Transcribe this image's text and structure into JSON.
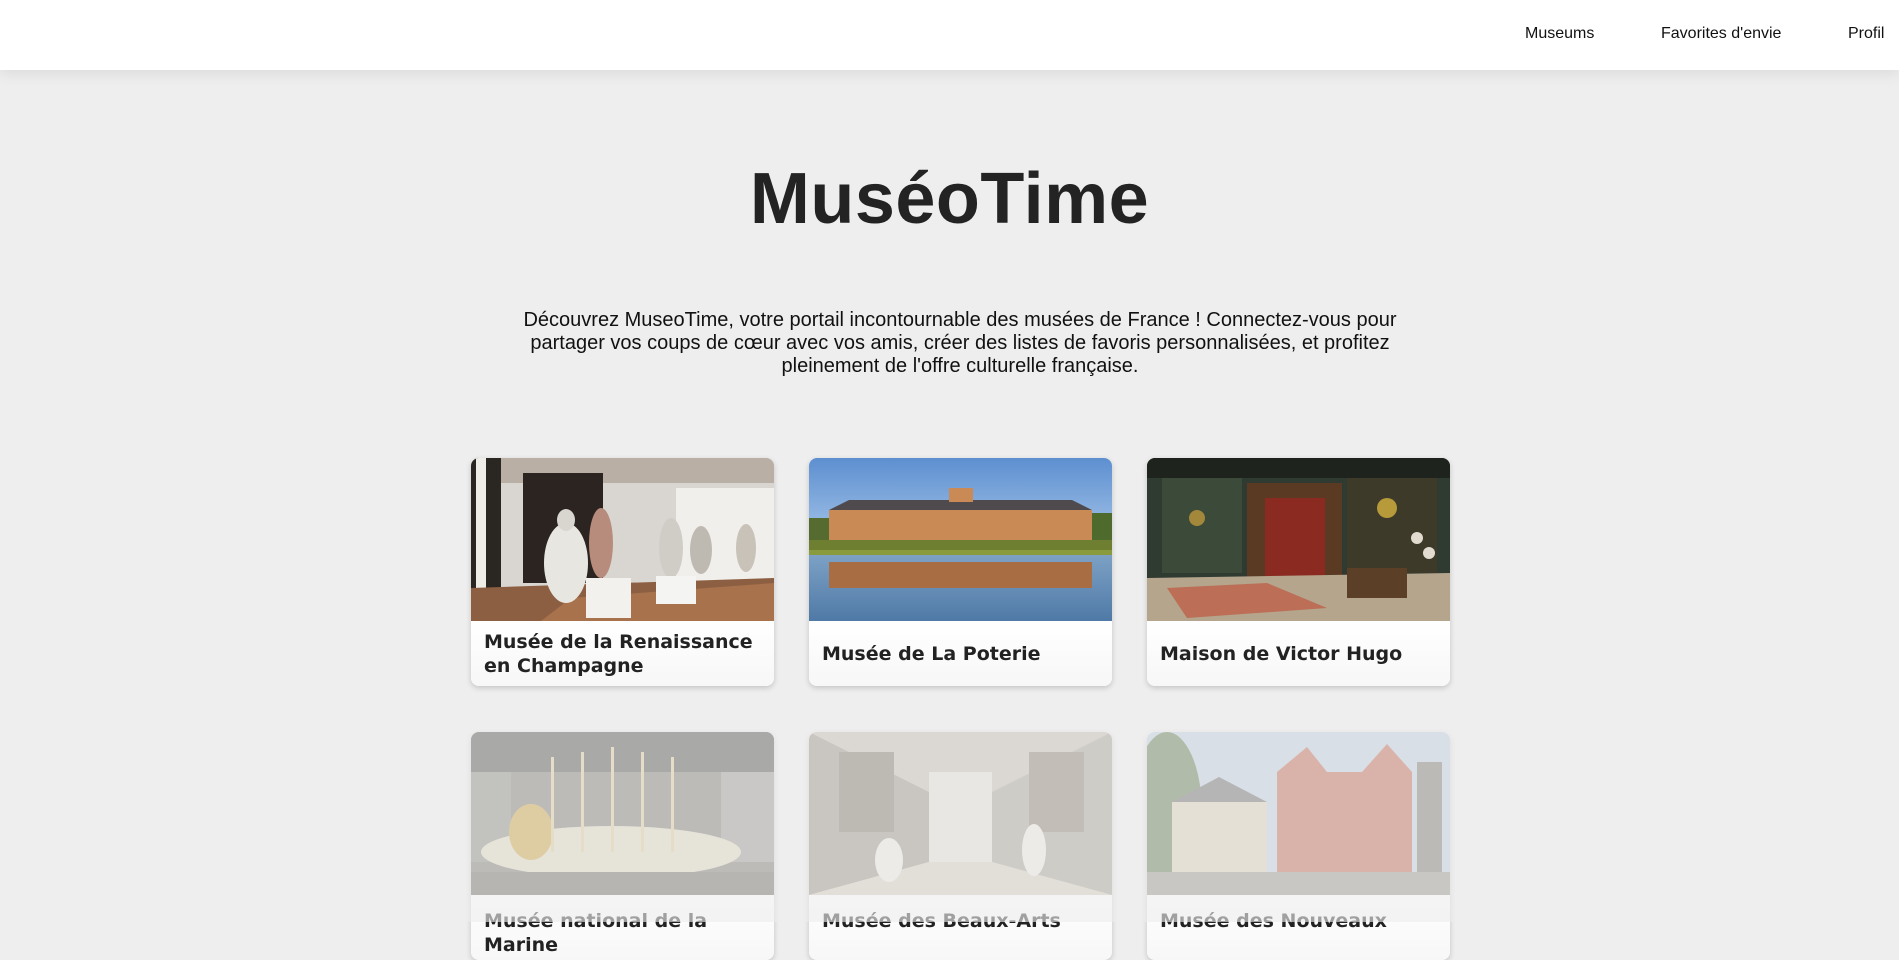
{
  "nav": {
    "museums": "Museums",
    "favorites": "Favorites d'envie",
    "profil": "Profil"
  },
  "hero": {
    "title": "MuséoTime",
    "description": "Découvrez MuseoTime, votre portail incontournable des musées de France ! Connectez-vous pour partager vos coups de cœur avec vos amis, créer des listes de favoris personnalisées, et profitez pleinement de l'offre culturelle française."
  },
  "museums": [
    {
      "title": "Musée de la Renaissance en Champagne"
    },
    {
      "title": "Musée de La Poterie"
    },
    {
      "title": "Maison de Victor Hugo"
    },
    {
      "title": "Musée national de la Marine"
    },
    {
      "title": "Musée des Beaux-Arts"
    },
    {
      "title": "Musée des Nouveaux"
    }
  ],
  "colors": {
    "page_background": "#eeeeee",
    "topbar_background": "#ffffff",
    "title_color": "#232323"
  }
}
